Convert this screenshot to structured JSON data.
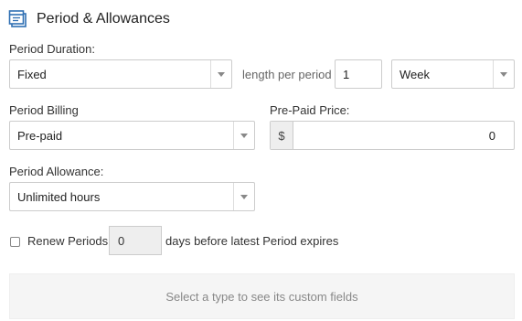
{
  "section": {
    "title": "Period & Allowances",
    "icon": "period-calendar-icon"
  },
  "duration": {
    "label": "Period Duration:",
    "selected": "Fixed",
    "length_label": "length per period",
    "length_value": "1",
    "unit_selected": "Week"
  },
  "billing": {
    "label": "Period Billing",
    "selected": "Pre-paid"
  },
  "prepaid": {
    "label": "Pre-Paid Price:",
    "currency": "$",
    "value": "0"
  },
  "allowance": {
    "label": "Period Allowance:",
    "selected": "Unlimited hours"
  },
  "renew": {
    "label": "Renew Periods",
    "days_value": "0",
    "suffix": "days before latest Period expires",
    "checked": false
  },
  "custom_fields": {
    "placeholder": "Select a type to see its custom fields"
  },
  "colors": {
    "border": "#cccccc",
    "addon_bg": "#eeeeee",
    "panel_bg": "#f5f5f5"
  }
}
